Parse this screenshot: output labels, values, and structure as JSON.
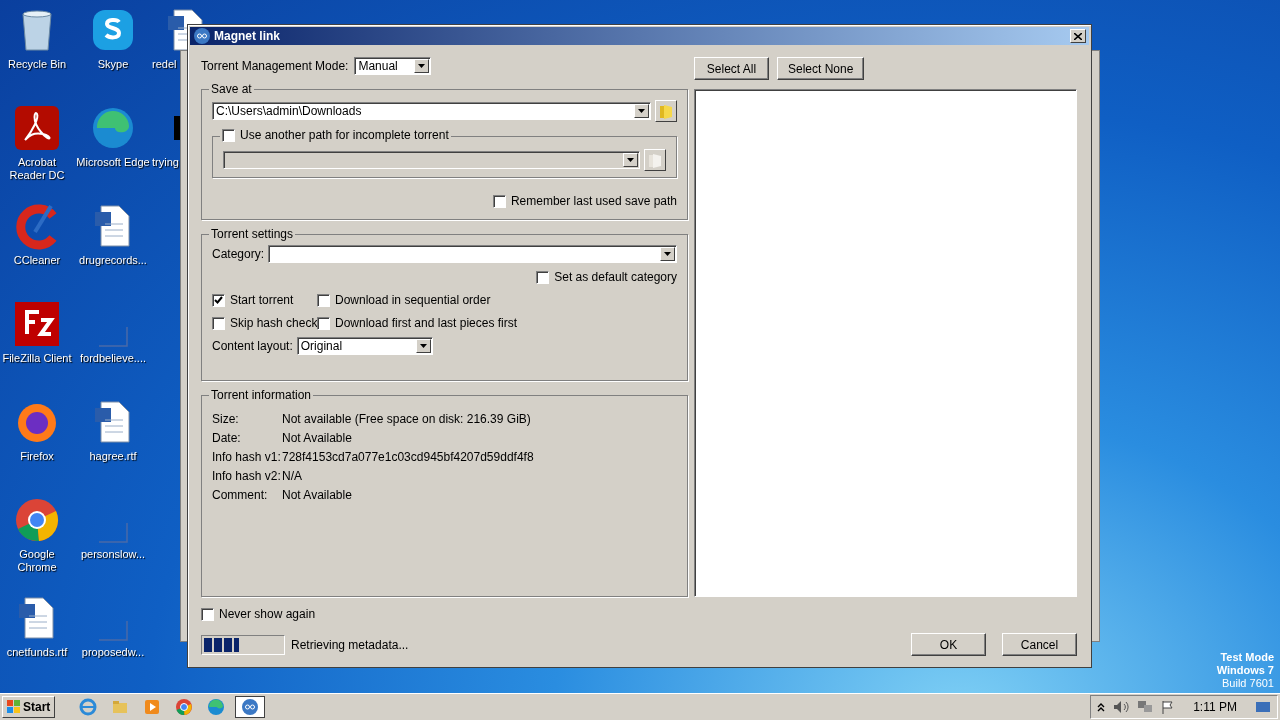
{
  "desktop_columns": [
    [
      {
        "label": "Recycle Bin",
        "kind": "bin"
      },
      {
        "label": "Acrobat Reader DC",
        "kind": "acrobat"
      },
      {
        "label": "CCleaner",
        "kind": "ccleaner"
      },
      {
        "label": "FileZilla Client",
        "kind": "filezilla"
      },
      {
        "label": "Firefox",
        "kind": "firefox"
      },
      {
        "label": "Google Chrome",
        "kind": "chrome"
      },
      {
        "label": "cnetfunds.rtf",
        "kind": "word"
      }
    ],
    [
      {
        "label": "Skype",
        "kind": "skype"
      },
      {
        "label": "Microsoft Edge",
        "kind": "edge"
      },
      {
        "label": "drugrecords...",
        "kind": "word"
      },
      {
        "label": "fordbelieve....",
        "kind": "blank"
      },
      {
        "label": "hagree.rtf",
        "kind": "word"
      },
      {
        "label": "personslow...",
        "kind": "blank"
      },
      {
        "label": "proposedw...",
        "kind": "blank"
      }
    ],
    [
      {
        "label": "redel",
        "kind": "word"
      },
      {
        "label": "trying",
        "kind": "dark"
      }
    ]
  ],
  "dialog": {
    "title": "Magnet link",
    "management_mode": {
      "label": "Torrent Management Mode:",
      "value": "Manual"
    },
    "save_at": {
      "title": "Save at",
      "path": "C:\\Users\\admin\\Downloads",
      "incomplete": {
        "label": "Use another path for incomplete torrent",
        "checked": false
      },
      "remember": {
        "label": "Remember last used save path",
        "checked": false
      }
    },
    "torrent_settings": {
      "title": "Torrent settings",
      "category_label": "Category:",
      "default_category": {
        "label": "Set as default category",
        "checked": false
      },
      "options": [
        {
          "label": "Start torrent",
          "checked": true
        },
        {
          "label": "Download in sequential order",
          "checked": false
        },
        {
          "label": "Skip hash check",
          "checked": false
        },
        {
          "label": "Download first and last pieces first",
          "checked": false
        }
      ],
      "content_layout": {
        "label": "Content layout:",
        "value": "Original"
      }
    },
    "torrent_information": {
      "title": "Torrent information",
      "rows": [
        {
          "label": "Size:",
          "value": "Not available (Free space on disk: 216.39 GiB)"
        },
        {
          "label": "Date:",
          "value": "Not Available"
        },
        {
          "label": "Info hash v1:",
          "value": "728f4153cd7a077e1c03cd945bf4207d59ddf4f8"
        },
        {
          "label": "Info hash v2:",
          "value": "N/A"
        },
        {
          "label": "Comment:",
          "value": "Not Available"
        }
      ]
    },
    "select_buttons": [
      "Select All",
      "Select None"
    ],
    "never_show": {
      "label": "Never show again",
      "checked": false
    },
    "progress": {
      "level": 0.45,
      "text": "Retrieving metadata..."
    },
    "buttons": [
      "OK",
      "Cancel"
    ]
  },
  "os_notice": [
    "Test Mode",
    "Windows 7",
    "Build 7601"
  ],
  "taskbar": {
    "start": "Start",
    "apps": [
      {
        "kind": "ie",
        "selected": false
      },
      {
        "kind": "folder",
        "selected": false
      },
      {
        "kind": "media",
        "selected": false
      },
      {
        "kind": "chrome",
        "selected": false
      },
      {
        "kind": "edge",
        "selected": false
      },
      {
        "kind": "qbittorrent",
        "selected": true
      }
    ],
    "clock": "1:11 PM"
  }
}
